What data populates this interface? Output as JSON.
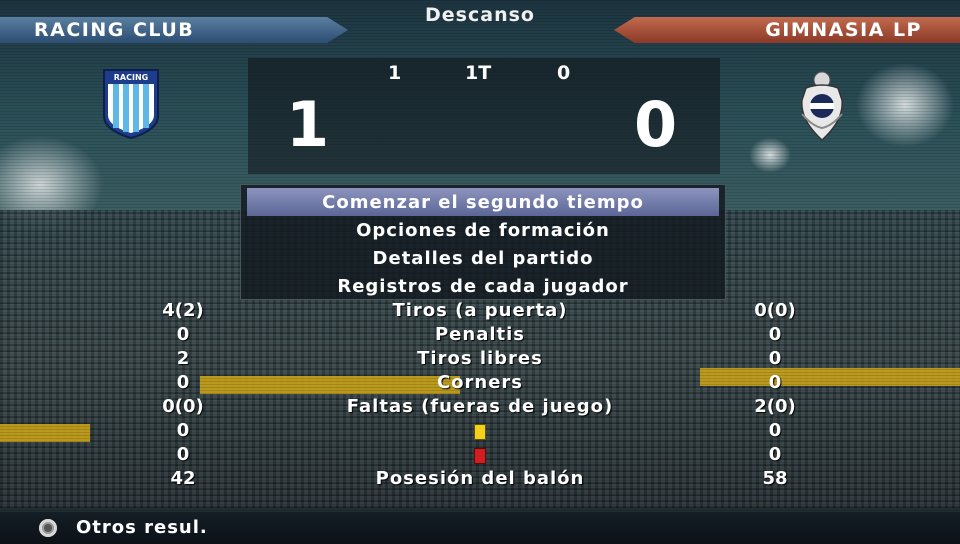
{
  "header": {
    "period_label": "Descanso",
    "home_team": "RACING CLUB",
    "away_team": "GIMNASIA LP",
    "home_crest_text": "RACING"
  },
  "scoreboard": {
    "half_home": "1",
    "half_label": "1T",
    "half_away": "0",
    "home_score": "1",
    "away_score": "0"
  },
  "menu": {
    "items": [
      {
        "label": "Comenzar el segundo tiempo",
        "selected": true
      },
      {
        "label": "Opciones de formación",
        "selected": false
      },
      {
        "label": "Detalles del partido",
        "selected": false
      },
      {
        "label": "Registros de cada jugador",
        "selected": false
      }
    ]
  },
  "stats": [
    {
      "label": "Tiros (a puerta)",
      "home": "4(2)",
      "away": "0(0)"
    },
    {
      "label": "Penaltis",
      "home": "0",
      "away": "0"
    },
    {
      "label": "Tiros libres",
      "home": "2",
      "away": "0"
    },
    {
      "label": "Corners",
      "home": "0",
      "away": "0"
    },
    {
      "label": "Faltas (fueras de juego)",
      "home": "0(0)",
      "away": "2(0)"
    },
    {
      "label": "",
      "icon": "yellow-card-icon",
      "home": "0",
      "away": "0"
    },
    {
      "label": "",
      "icon": "red-card-icon",
      "home": "0",
      "away": "0"
    },
    {
      "label": "Posesión del balón",
      "home": "42",
      "away": "58"
    }
  ],
  "footer": {
    "button_icon": "circle-button-icon",
    "label": "Otros resul."
  },
  "colors": {
    "home_tab": "#2c4d72",
    "away_tab": "#8a3a28",
    "menu_selected": "#6c76a6",
    "yellow_card": "#f1d11b",
    "red_card": "#d11e1e"
  }
}
